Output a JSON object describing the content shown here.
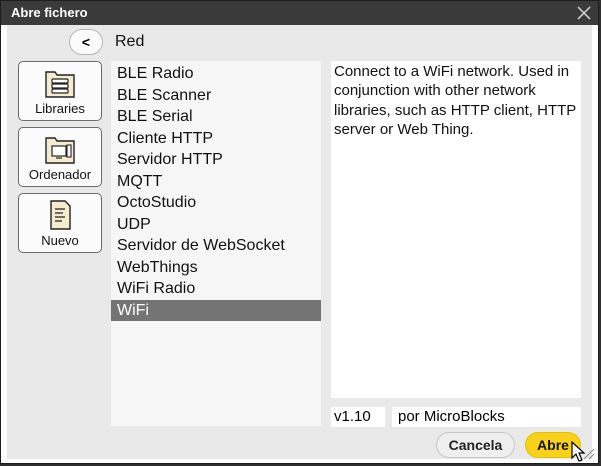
{
  "window": {
    "title": "Abre fichero"
  },
  "nav": {
    "back_label": "<",
    "path": "Red"
  },
  "sidebar": [
    {
      "label": "Libraries",
      "icon": "libraries-icon"
    },
    {
      "label": "Ordenador",
      "icon": "computer-folder-icon"
    },
    {
      "label": "Nuevo",
      "icon": "new-file-icon"
    }
  ],
  "libraries": [
    "BLE Radio",
    "BLE Scanner",
    "BLE Serial",
    "Cliente HTTP",
    "Servidor HTTP",
    "MQTT",
    "OctoStudio",
    "UDP",
    "Servidor de WebSocket",
    "WebThings",
    "WiFi Radio",
    "WiFi"
  ],
  "selected_library": "WiFi",
  "details": {
    "description": "Connect to a WiFi network. Used in conjunction with other network libraries, such as HTTP client, HTTP server or Web Thing.",
    "version": "v1.10",
    "author": "por MicroBlocks"
  },
  "buttons": {
    "cancel": "Cancela",
    "open": "Abre"
  },
  "colors": {
    "accent": "#f8d21a",
    "selection": "#747474",
    "titlebar": "#3a3a3a",
    "panel": "#e9e9e9"
  }
}
